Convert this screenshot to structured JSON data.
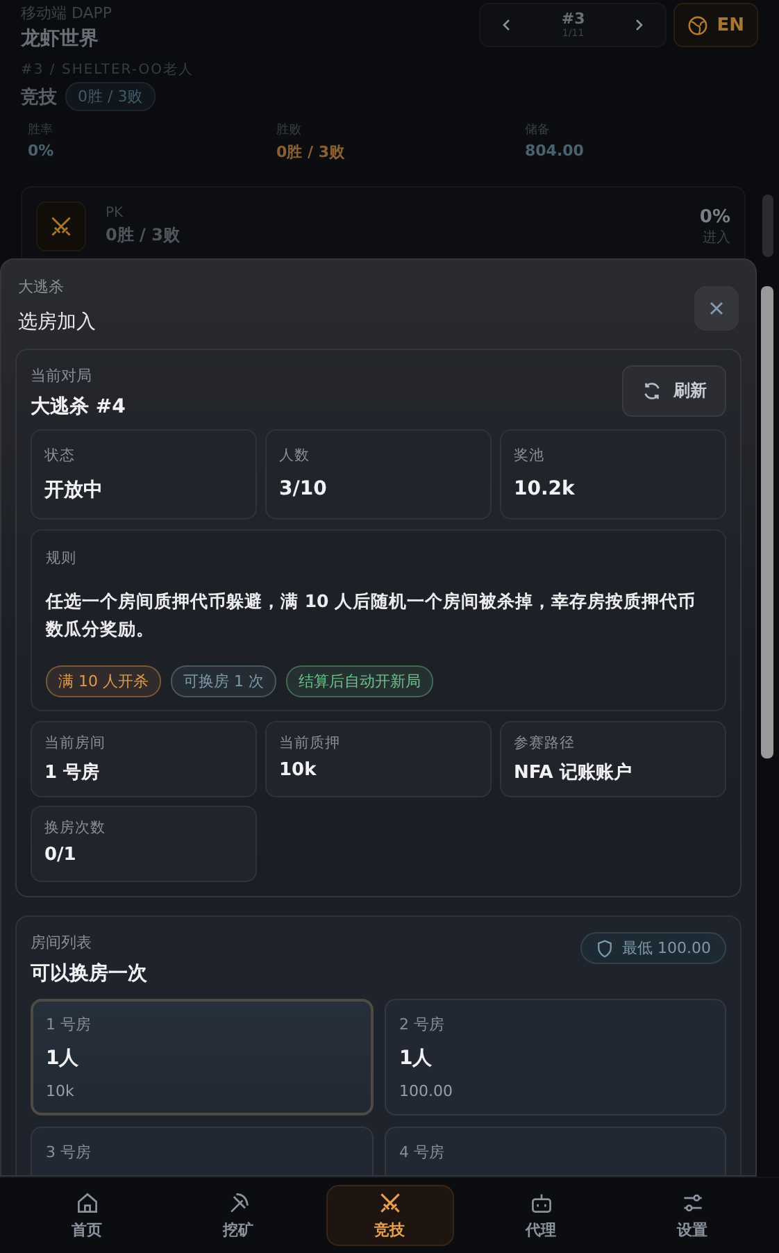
{
  "app": {
    "subtitle": "移动端 DAPP",
    "title": "龙虾世界",
    "breadcrumb": "#3 / SHELTER-OO老人"
  },
  "pager": {
    "current": "#3",
    "position": "1/11"
  },
  "language": {
    "label": "EN"
  },
  "section": {
    "title": "竞技",
    "record": "0胜 / 3败"
  },
  "stats": [
    {
      "label": "胜率",
      "value": "0%",
      "color": "#4a6270"
    },
    {
      "label": "胜败",
      "value": "0胜 / 3败",
      "color": "#8a6030"
    },
    {
      "label": "储备",
      "value": "804.00",
      "color": "#4a6270"
    }
  ],
  "pk_card": {
    "label": "PK",
    "record": "0胜 / 3败",
    "percent": "0%",
    "action": "进入"
  },
  "sheet": {
    "eyebrow": "大逃杀",
    "title": "选房加入",
    "current": {
      "label": "当前对局",
      "title": "大逃杀 #4",
      "refresh": "刷新",
      "stats": [
        {
          "label": "状态",
          "value": "开放中"
        },
        {
          "label": "人数",
          "value": "3/10"
        },
        {
          "label": "奖池",
          "value": "10.2k"
        }
      ],
      "rules": {
        "label": "规则",
        "text": "任选一个房间质押代币躲避，满 10 人后随机一个房间被杀掉，幸存房按质押代币数瓜分奖励。",
        "tags": [
          {
            "text": "满 10 人开杀",
            "color": "#e09a4a"
          },
          {
            "text": "可换房 1 次",
            "color": "#7a9aaa"
          },
          {
            "text": "结算后自动开新局",
            "color": "#6cc08a"
          }
        ]
      },
      "details": [
        {
          "label": "当前房间",
          "value": "1 号房"
        },
        {
          "label": "当前质押",
          "value": "10k"
        },
        {
          "label": "参赛路径",
          "value": "NFA 记账账户"
        },
        {
          "label": "换房次数",
          "value": "0/1"
        }
      ]
    },
    "rooms": {
      "label": "房间列表",
      "title": "可以换房一次",
      "minimum": "最低 100.00",
      "items": [
        {
          "name": "1 号房",
          "count": "1人",
          "stake": "10k",
          "selected": true
        },
        {
          "name": "2 号房",
          "count": "1人",
          "stake": "100.00",
          "selected": false
        },
        {
          "name": "3 号房",
          "selected": false
        },
        {
          "name": "4 号房",
          "selected": false
        }
      ]
    }
  },
  "nav": [
    {
      "label": "首页",
      "selected": false
    },
    {
      "label": "挖矿",
      "selected": false
    },
    {
      "label": "竞技",
      "selected": true
    },
    {
      "label": "代理",
      "selected": false
    },
    {
      "label": "设置",
      "selected": false
    }
  ]
}
